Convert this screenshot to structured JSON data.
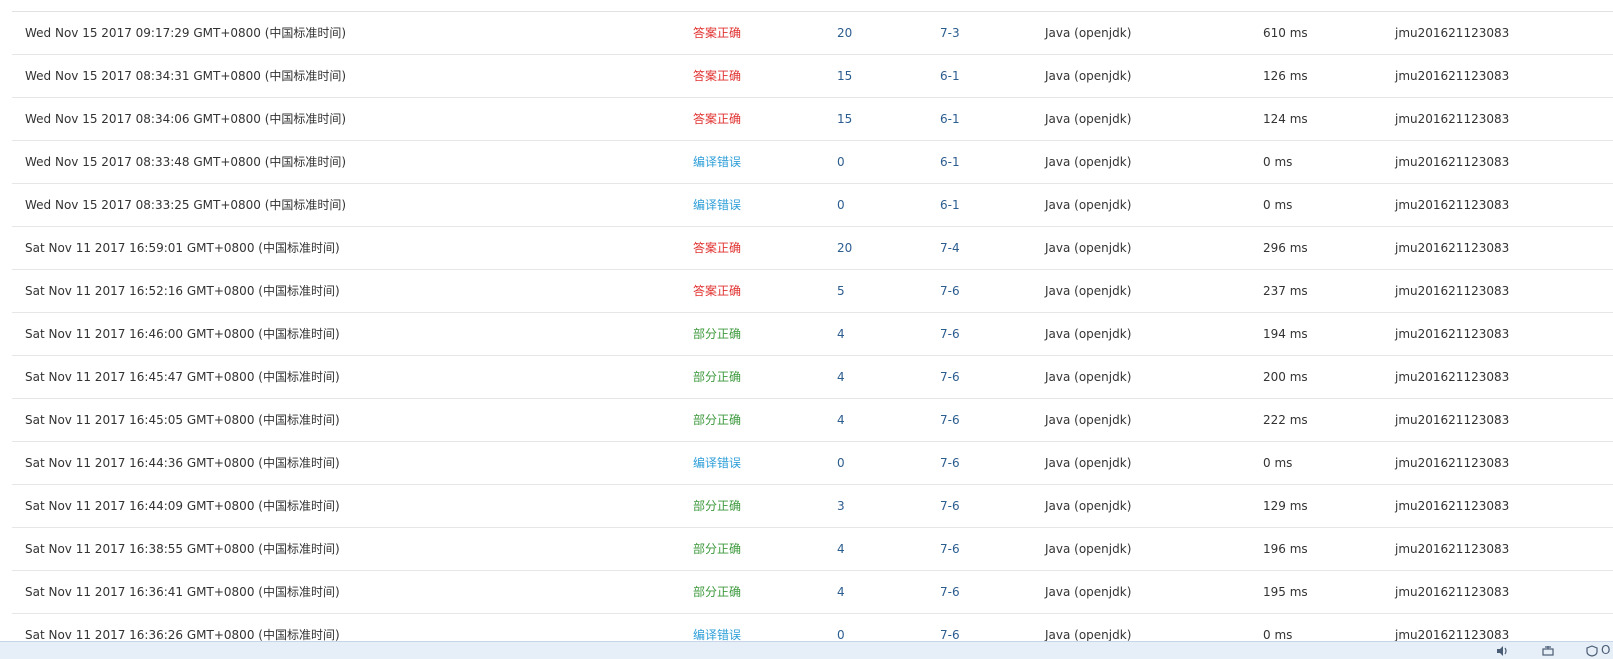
{
  "submissions": [
    {
      "time": "Wed Nov 15 2017 09:17:29 GMT+0800 (中国标准时间)",
      "status": "答案正确",
      "status_type": "accepted",
      "score": "20",
      "problem": "7-3",
      "language": "Java (openjdk)",
      "run_time": "610 ms",
      "user": "jmu201621123083"
    },
    {
      "time": "Wed Nov 15 2017 08:34:31 GMT+0800 (中国标准时间)",
      "status": "答案正确",
      "status_type": "accepted",
      "score": "15",
      "problem": "6-1",
      "language": "Java (openjdk)",
      "run_time": "126 ms",
      "user": "jmu201621123083"
    },
    {
      "time": "Wed Nov 15 2017 08:34:06 GMT+0800 (中国标准时间)",
      "status": "答案正确",
      "status_type": "accepted",
      "score": "15",
      "problem": "6-1",
      "language": "Java (openjdk)",
      "run_time": "124 ms",
      "user": "jmu201621123083"
    },
    {
      "time": "Wed Nov 15 2017 08:33:48 GMT+0800 (中国标准时间)",
      "status": "编译错误",
      "status_type": "compile",
      "score": "0",
      "problem": "6-1",
      "language": "Java (openjdk)",
      "run_time": "0 ms",
      "user": "jmu201621123083"
    },
    {
      "time": "Wed Nov 15 2017 08:33:25 GMT+0800 (中国标准时间)",
      "status": "编译错误",
      "status_type": "compile",
      "score": "0",
      "problem": "6-1",
      "language": "Java (openjdk)",
      "run_time": "0 ms",
      "user": "jmu201621123083"
    },
    {
      "time": "Sat Nov 11 2017 16:59:01 GMT+0800 (中国标准时间)",
      "status": "答案正确",
      "status_type": "accepted",
      "score": "20",
      "problem": "7-4",
      "language": "Java (openjdk)",
      "run_time": "296 ms",
      "user": "jmu201621123083"
    },
    {
      "time": "Sat Nov 11 2017 16:52:16 GMT+0800 (中国标准时间)",
      "status": "答案正确",
      "status_type": "accepted",
      "score": "5",
      "problem": "7-6",
      "language": "Java (openjdk)",
      "run_time": "237 ms",
      "user": "jmu201621123083"
    },
    {
      "time": "Sat Nov 11 2017 16:46:00 GMT+0800 (中国标准时间)",
      "status": "部分正确",
      "status_type": "partial",
      "score": "4",
      "problem": "7-6",
      "language": "Java (openjdk)",
      "run_time": "194 ms",
      "user": "jmu201621123083"
    },
    {
      "time": "Sat Nov 11 2017 16:45:47 GMT+0800 (中国标准时间)",
      "status": "部分正确",
      "status_type": "partial",
      "score": "4",
      "problem": "7-6",
      "language": "Java (openjdk)",
      "run_time": "200 ms",
      "user": "jmu201621123083"
    },
    {
      "time": "Sat Nov 11 2017 16:45:05 GMT+0800 (中国标准时间)",
      "status": "部分正确",
      "status_type": "partial",
      "score": "4",
      "problem": "7-6",
      "language": "Java (openjdk)",
      "run_time": "222 ms",
      "user": "jmu201621123083"
    },
    {
      "time": "Sat Nov 11 2017 16:44:36 GMT+0800 (中国标准时间)",
      "status": "编译错误",
      "status_type": "compile",
      "score": "0",
      "problem": "7-6",
      "language": "Java (openjdk)",
      "run_time": "0 ms",
      "user": "jmu201621123083"
    },
    {
      "time": "Sat Nov 11 2017 16:44:09 GMT+0800 (中国标准时间)",
      "status": "部分正确",
      "status_type": "partial",
      "score": "3",
      "problem": "7-6",
      "language": "Java (openjdk)",
      "run_time": "129 ms",
      "user": "jmu201621123083"
    },
    {
      "time": "Sat Nov 11 2017 16:38:55 GMT+0800 (中国标准时间)",
      "status": "部分正确",
      "status_type": "partial",
      "score": "4",
      "problem": "7-6",
      "language": "Java (openjdk)",
      "run_time": "196 ms",
      "user": "jmu201621123083"
    },
    {
      "time": "Sat Nov 11 2017 16:36:41 GMT+0800 (中国标准时间)",
      "status": "部分正确",
      "status_type": "partial",
      "score": "4",
      "problem": "7-6",
      "language": "Java (openjdk)",
      "run_time": "195 ms",
      "user": "jmu201621123083"
    },
    {
      "time": "Sat Nov 11 2017 16:36:26 GMT+0800 (中国标准时间)",
      "status": "编译错误",
      "status_type": "compile",
      "score": "0",
      "problem": "7-6",
      "language": "Java (openjdk)",
      "run_time": "0 ms",
      "user": "jmu201621123083"
    }
  ],
  "status_colors": {
    "accepted": "#e0312f",
    "compile": "#2f9fd8",
    "partial": "#3e9a3e"
  },
  "system_tray": {
    "icons": [
      "speaker-icon",
      "network-icon",
      "shield-icon"
    ],
    "overflow_text": "O"
  }
}
